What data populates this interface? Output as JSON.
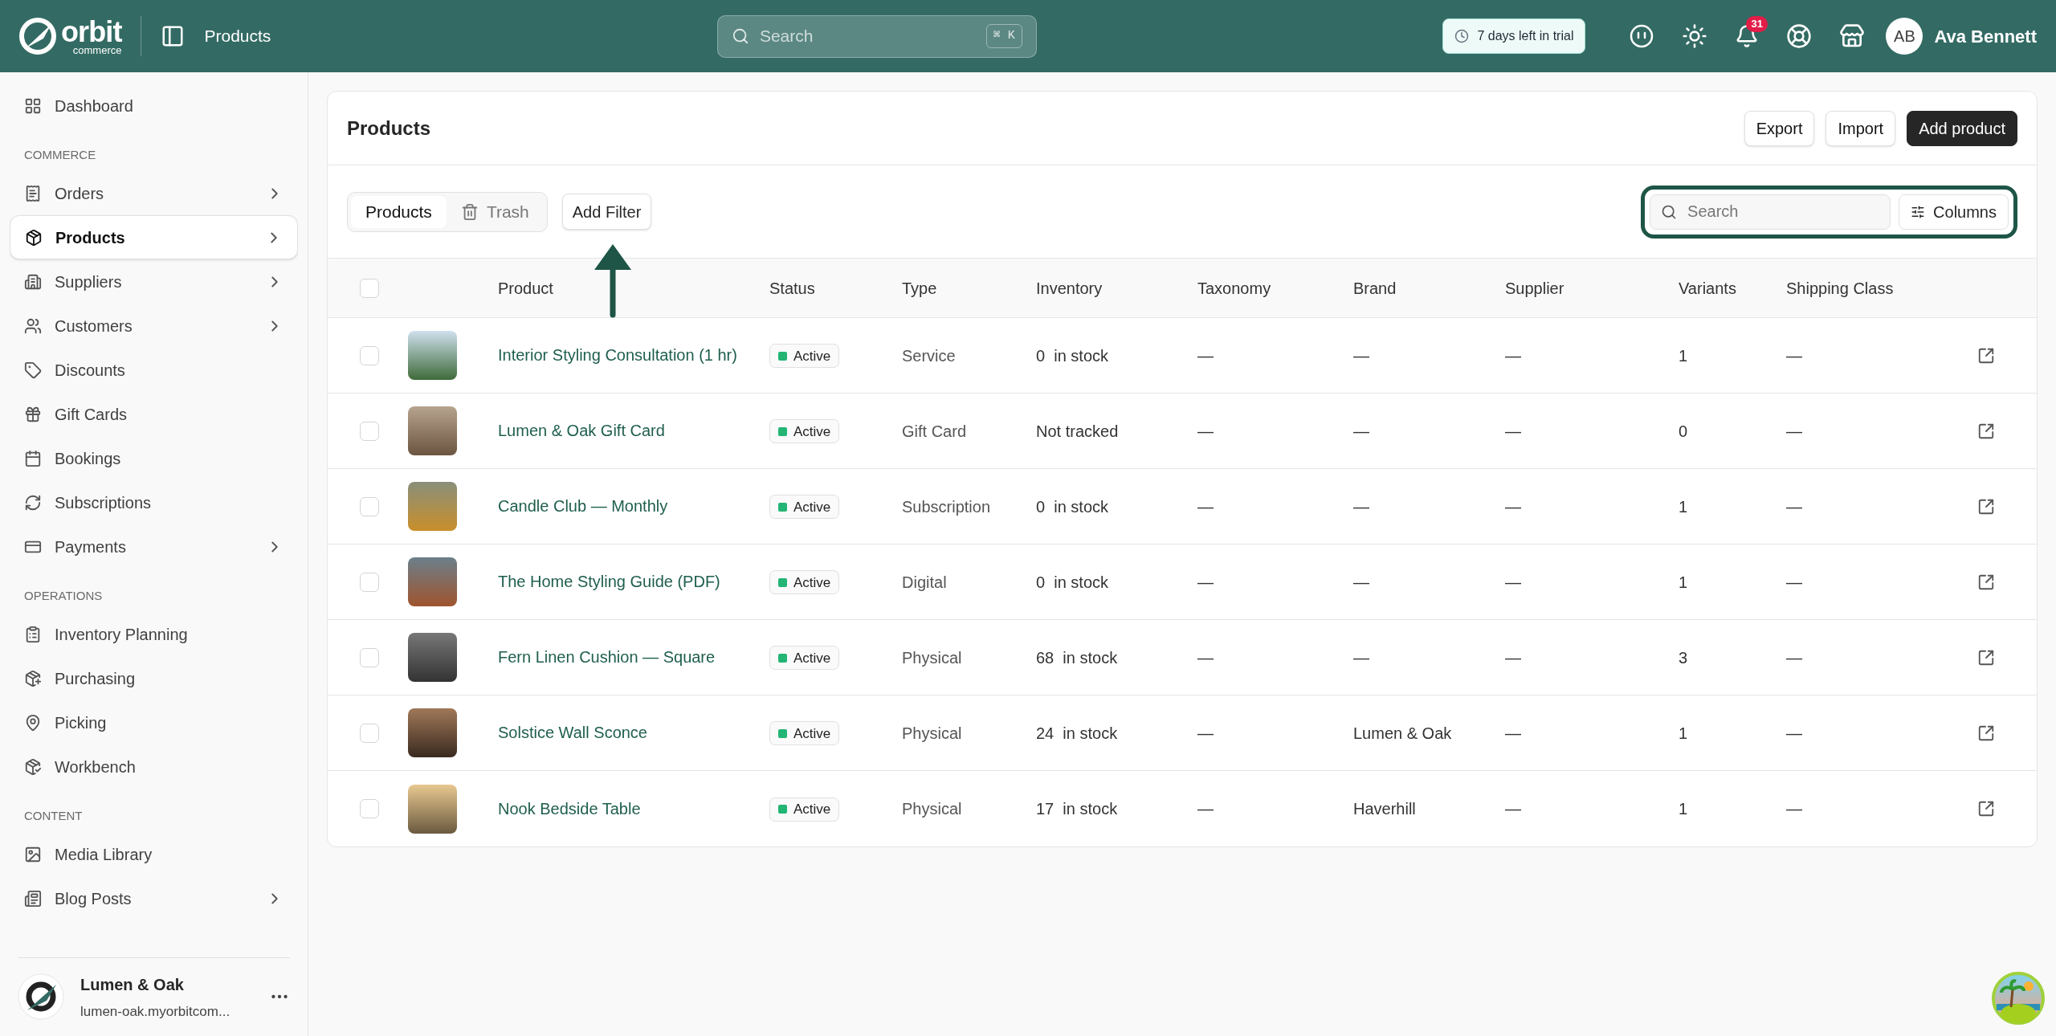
{
  "topbar": {
    "logo": {
      "name": "orbit",
      "tagline": "commerce"
    },
    "breadcrumb": "Products",
    "search": {
      "placeholder": "Search",
      "shortcut": "⌘ K"
    },
    "trial": "7 days left in trial",
    "notifications": "31",
    "user": {
      "initials": "AB",
      "name": "Ava Bennett"
    }
  },
  "sidebar": {
    "sections": [
      {
        "items": [
          {
            "label": "Dashboard",
            "selected": false,
            "expandable": false
          }
        ]
      },
      {
        "title": "COMMERCE",
        "items": [
          {
            "label": "Orders",
            "selected": false,
            "expandable": true
          },
          {
            "label": "Products",
            "selected": true,
            "expandable": true
          },
          {
            "label": "Suppliers",
            "selected": false,
            "expandable": true
          },
          {
            "label": "Customers",
            "selected": false,
            "expandable": true
          },
          {
            "label": "Discounts",
            "selected": false,
            "expandable": false
          },
          {
            "label": "Gift Cards",
            "selected": false,
            "expandable": false
          },
          {
            "label": "Bookings",
            "selected": false,
            "expandable": false
          },
          {
            "label": "Subscriptions",
            "selected": false,
            "expandable": false
          },
          {
            "label": "Payments",
            "selected": false,
            "expandable": true
          }
        ]
      },
      {
        "title": "OPERATIONS",
        "items": [
          {
            "label": "Inventory Planning",
            "selected": false,
            "expandable": false
          },
          {
            "label": "Purchasing",
            "selected": false,
            "expandable": false
          },
          {
            "label": "Picking",
            "selected": false,
            "expandable": false
          },
          {
            "label": "Workbench",
            "selected": false,
            "expandable": false
          }
        ]
      },
      {
        "title": "CONTENT",
        "items": [
          {
            "label": "Media Library",
            "selected": false,
            "expandable": false
          },
          {
            "label": "Blog Posts",
            "selected": false,
            "expandable": true
          }
        ]
      }
    ],
    "store": {
      "name": "Lumen & Oak",
      "domain": "lumen-oak.myorbitcom..."
    }
  },
  "page": {
    "title": "Products",
    "actions": [
      {
        "label": "Export",
        "primary": false
      },
      {
        "label": "Import",
        "primary": false
      },
      {
        "label": "Add product",
        "primary": true
      }
    ],
    "views": [
      {
        "label": "Products",
        "selected": true
      },
      {
        "label": "Trash",
        "selected": false
      }
    ],
    "filter_button": "Add Filter",
    "search": {
      "placeholder": "Search"
    },
    "columns_button": "Columns"
  },
  "table": {
    "all_checked": false,
    "columns": [
      "Product",
      "Status",
      "Type",
      "Inventory",
      "Taxonomy",
      "Brand",
      "Supplier",
      "Variants",
      "Shipping Class"
    ],
    "rows": [
      {
        "checked": false,
        "product": "Interior Styling Consultation (1 hr)",
        "status": "Active",
        "type": "Service",
        "inventory": {
          "count": "0",
          "unit": "in stock"
        },
        "taxonomy": "—",
        "brand": "—",
        "supplier": "—",
        "variants": "1",
        "shipping": "—"
      },
      {
        "checked": false,
        "product": "Lumen & Oak Gift Card",
        "status": "Active",
        "type": "Gift Card",
        "inventory": {
          "unit": "Not tracked"
        },
        "taxonomy": "—",
        "brand": "—",
        "supplier": "—",
        "variants": "0",
        "shipping": "—"
      },
      {
        "checked": false,
        "product": "Candle Club — Monthly",
        "status": "Active",
        "type": "Subscription",
        "inventory": {
          "count": "0",
          "unit": "in stock"
        },
        "taxonomy": "—",
        "brand": "—",
        "supplier": "—",
        "variants": "1",
        "shipping": "—"
      },
      {
        "checked": false,
        "product": "The Home Styling Guide (PDF)",
        "status": "Active",
        "type": "Digital",
        "inventory": {
          "count": "0",
          "unit": "in stock"
        },
        "taxonomy": "—",
        "brand": "—",
        "supplier": "—",
        "variants": "1",
        "shipping": "—"
      },
      {
        "checked": false,
        "product": "Fern Linen Cushion — Square",
        "status": "Active",
        "type": "Physical",
        "inventory": {
          "count": "68",
          "unit": "in stock"
        },
        "taxonomy": "—",
        "brand": "—",
        "supplier": "—",
        "variants": "3",
        "shipping": "—"
      },
      {
        "checked": false,
        "product": "Solstice Wall Sconce",
        "status": "Active",
        "type": "Physical",
        "inventory": {
          "count": "24",
          "unit": "in stock"
        },
        "taxonomy": "—",
        "brand": "Lumen & Oak",
        "supplier": "—",
        "variants": "1",
        "shipping": "—"
      },
      {
        "checked": false,
        "product": "Nook Bedside Table",
        "status": "Active",
        "type": "Physical",
        "inventory": {
          "count": "17",
          "unit": "in stock"
        },
        "taxonomy": "—",
        "brand": "Haverhill",
        "supplier": "—",
        "variants": "1",
        "shipping": "—"
      }
    ]
  }
}
